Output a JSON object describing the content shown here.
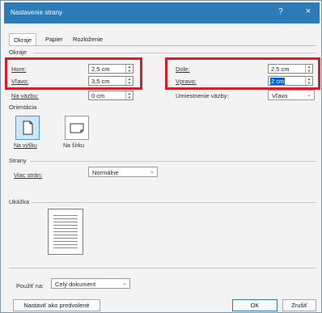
{
  "window": {
    "title": "Nastavenie strany",
    "help": "?",
    "close": "×"
  },
  "tabs": [
    {
      "label": "Okraje",
      "active": true
    },
    {
      "label": "Papier",
      "active": false
    },
    {
      "label": "Rozloženie",
      "active": false
    }
  ],
  "margins": {
    "section_label": "Okraje",
    "top": {
      "label": "Hore:",
      "value": "2,5 cm"
    },
    "left": {
      "label": "Vľavo:",
      "value": "3,5 cm"
    },
    "gutter": {
      "label": "Na väzbu:",
      "value": "0 cm"
    },
    "bottom": {
      "label": "Dole:",
      "value": "2,5 cm"
    },
    "right": {
      "label": "Vpravo:",
      "value": "2 cm"
    },
    "gutter_position": {
      "label": "Umiestnenie väzby:",
      "value": "Vľavo"
    }
  },
  "orientation": {
    "section_label": "Orientácia",
    "portrait": "Na výšku",
    "landscape": "Na šírku"
  },
  "pages": {
    "section_label": "Strany",
    "multiple_label": "Viac strán:",
    "multiple_value": "Normálne"
  },
  "preview": {
    "section_label": "Ukážka"
  },
  "apply": {
    "label": "Použiť na:",
    "value": "Celý dokument"
  },
  "buttons": {
    "set_default": "Nastaviť ako predvolené",
    "ok": "OK",
    "cancel": "Zrušiť"
  },
  "colors": {
    "titlebar": "#2b7bb9",
    "highlight": "#d81e2c",
    "selection": "#0a63c9"
  }
}
